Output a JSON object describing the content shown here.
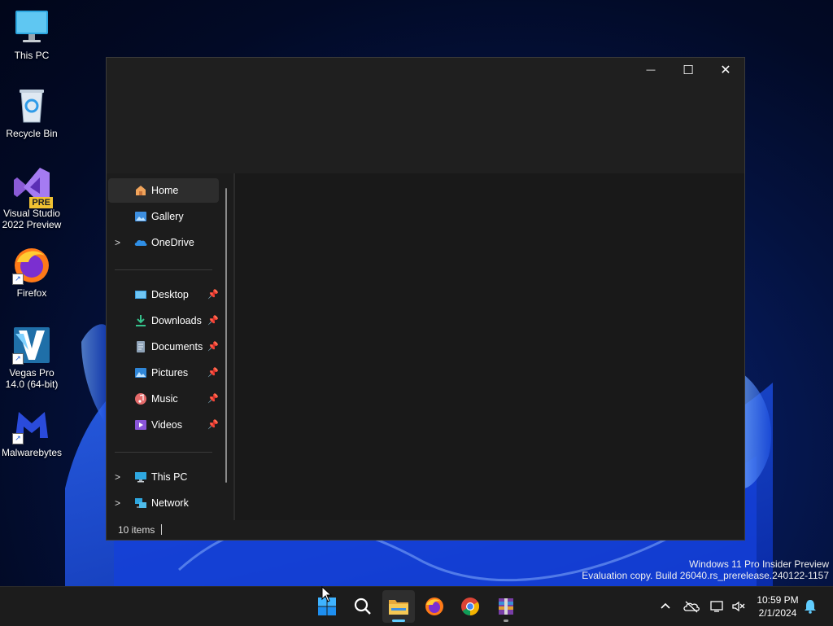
{
  "desktop": {
    "icons": [
      {
        "label": "This PC",
        "icon": "monitor-icon"
      },
      {
        "label": "Recycle Bin",
        "icon": "recycle-bin-icon"
      },
      {
        "label": "Visual Studio 2022 Preview",
        "icon": "visual-studio-icon",
        "badge": "PRE"
      },
      {
        "label": "Firefox",
        "icon": "firefox-icon"
      },
      {
        "label": "Vegas Pro 14.0 (64-bit)",
        "icon": "vegas-pro-icon"
      },
      {
        "label": "Malwarebytes",
        "icon": "malwarebytes-icon"
      }
    ]
  },
  "explorer": {
    "window_controls": {
      "minimize": "—",
      "maximize": "☐",
      "close": "✕"
    },
    "nav": {
      "quick": [
        {
          "label": "Home",
          "icon": "home-icon",
          "selected": true
        },
        {
          "label": "Gallery",
          "icon": "gallery-icon"
        },
        {
          "label": "OneDrive",
          "icon": "onedrive-icon",
          "expandable": true
        }
      ],
      "pinned": [
        {
          "label": "Desktop",
          "icon": "desktop-folder-icon"
        },
        {
          "label": "Downloads",
          "icon": "downloads-icon"
        },
        {
          "label": "Documents",
          "icon": "documents-icon"
        },
        {
          "label": "Pictures",
          "icon": "pictures-icon"
        },
        {
          "label": "Music",
          "icon": "music-icon"
        },
        {
          "label": "Videos",
          "icon": "videos-icon"
        }
      ],
      "locations": [
        {
          "label": "This PC",
          "icon": "this-pc-icon",
          "expandable": true
        },
        {
          "label": "Network",
          "icon": "network-icon",
          "expandable": true
        }
      ]
    },
    "status": {
      "item_count": "10 items"
    }
  },
  "watermark": {
    "line1": "Windows 11 Pro Insider Preview",
    "line2": "Evaluation copy. Build 26040.rs_prerelease.240122-1157"
  },
  "taskbar": {
    "apps": [
      "start-icon",
      "search-icon",
      "file-explorer-icon",
      "firefox-icon",
      "chrome-icon",
      "winrar-icon"
    ],
    "clock": {
      "time": "10:59 PM",
      "date": "2/1/2024"
    }
  },
  "colors": {
    "accent": "#60cdff",
    "window_bg": "#1c1c1c",
    "taskbar_bg": "#1c1c1c"
  }
}
